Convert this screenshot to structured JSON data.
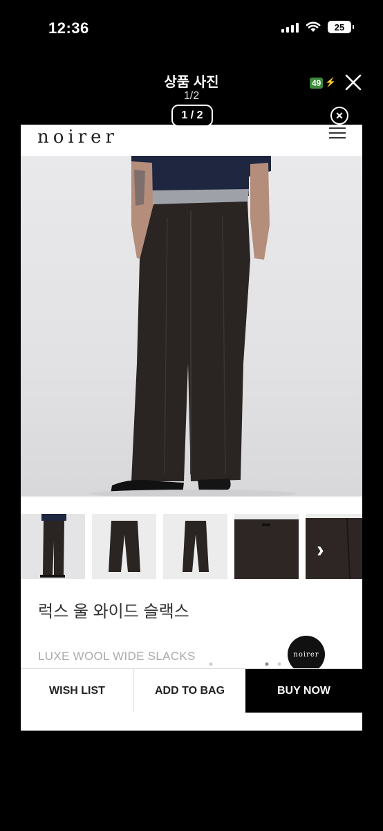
{
  "status_bar": {
    "time": "12:36",
    "battery": "25"
  },
  "viewer": {
    "title": "상품 사진",
    "counter": "1/2",
    "page_pill": "1 / 2",
    "charge_badge": "49"
  },
  "site": {
    "logo": "noirer",
    "product_name_ko": "럭스 울 와이드 슬랙스",
    "product_name_en": "LUXE WOOL WIDE SLACKS",
    "brand_badge": "noirer"
  },
  "buttons": {
    "wish": "WISH LIST",
    "bag": "ADD TO BAG",
    "buy": "BUY NOW"
  },
  "icons": [
    "signal-icon",
    "wifi-icon",
    "battery-icon",
    "close-icon",
    "menu-icon",
    "chevron-right-icon"
  ]
}
